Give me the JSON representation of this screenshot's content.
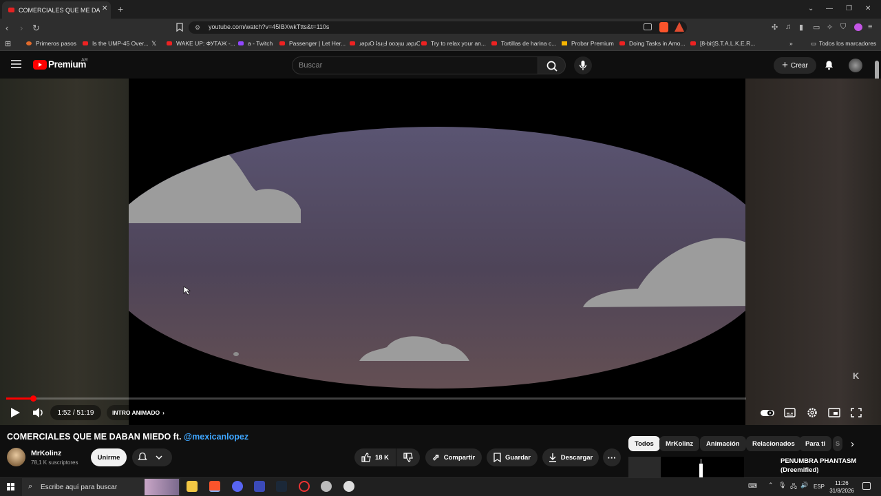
{
  "browser": {
    "tab_title": "COMERCIALES QUE ME DABAN MIEDO ft. @mexicanlopez",
    "url": "youtube.com/watch?v=45IBXwkTtts&t=110s",
    "bookmarks": [
      "Primeros pasos",
      "Is the UMP-45 Over...",
      "WAKE UP: ФУТАЖ -...",
      "a - Twitch",
      "Passenger | Let Her...",
      "ɹəpɹO ʇsɹᴉℲ ooɔᴉɯ ɹəpɹO...",
      "Try to relax your an...",
      "Tortillas de harina c...",
      "Probar Premium",
      "Doing Tasks in Amo...",
      "[8-bit]S.T.A.L.K.E.R..."
    ],
    "all_bookmarks": "Todos los marcadores"
  },
  "youtube": {
    "logo_text": "Premium",
    "region": "AR",
    "search_placeholder": "Buscar",
    "create_label": "Crear"
  },
  "player": {
    "time": "1:52 / 51:19",
    "chapter": "INTRO ANIMADO",
    "progress": 0.036,
    "watermark": "K"
  },
  "video": {
    "title_main": "COMERCIALES QUE ME DABAN MIEDO ft. ",
    "title_mention": "@mexicanlopez",
    "channel": "MrKolinz",
    "subscribers": "78,1 K suscriptores",
    "join_label": "Unirme",
    "likes": "18 K",
    "share_label": "Compartir",
    "save_label": "Guardar",
    "download_label": "Descargar"
  },
  "chips": [
    "Todos",
    "MrKolinz",
    "Animación",
    "Relacionados",
    "Para ti",
    "S"
  ],
  "recommendation": {
    "title": "PENUMBRA PHANTASM (Dreemified)"
  },
  "taskbar": {
    "search_placeholder": "Escribe aquí para buscar",
    "lang": "ESP",
    "time": "11:26",
    "date": "31/8/2026"
  }
}
